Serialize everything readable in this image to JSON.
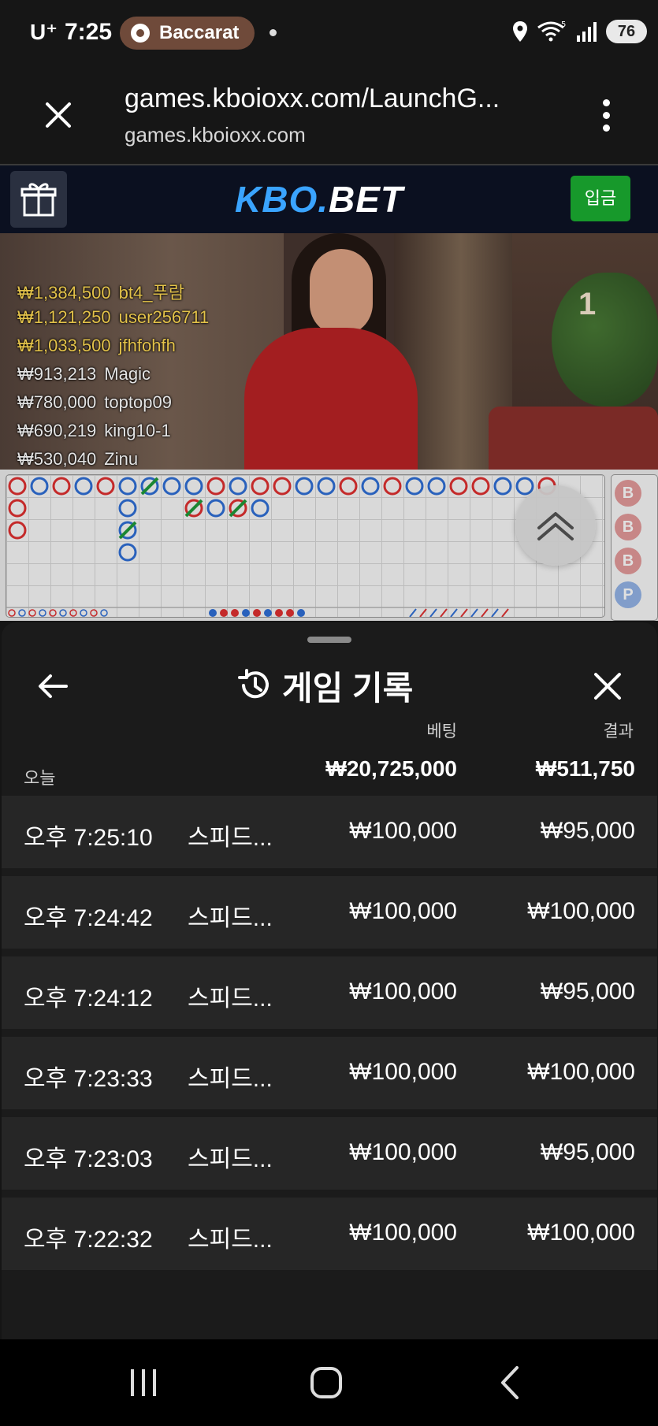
{
  "status_bar": {
    "carrier": "U⁺",
    "time": "7:25",
    "app_chip": "Baccarat",
    "battery": "76"
  },
  "browser": {
    "url_title": "games.kboioxx.com/LaunchG...",
    "domain": "games.kboioxx.com"
  },
  "site_header": {
    "logo_part1": "KBO.",
    "logo_part2": "BET",
    "deposit_label": "입금"
  },
  "video": {
    "shoe_number": "1",
    "winners": [
      {
        "amount": "₩1,384,500",
        "user": "bt4_푸람",
        "highlight": true
      },
      {
        "amount": "₩1,121,250",
        "user": "user256711",
        "highlight": true
      },
      {
        "amount": "₩1,033,500",
        "user": "jfhfohfh",
        "highlight": true
      },
      {
        "amount": "₩913,213",
        "user": "Magic",
        "highlight": false
      },
      {
        "amount": "₩780,000",
        "user": "toptop09",
        "highlight": false
      },
      {
        "amount": "₩690,219",
        "user": "king10-1",
        "highlight": false
      },
      {
        "amount": "₩530,040",
        "user": "Zinu",
        "highlight": false
      }
    ]
  },
  "roadmap": {
    "bead_road": [
      "B",
      "B",
      "B",
      "P"
    ]
  },
  "history": {
    "title": "게임 기록",
    "bet_header": "베팅",
    "result_header": "결과",
    "today_label": "오늘",
    "total_bet": "₩20,725,000",
    "total_result": "₩511,750",
    "rows": [
      {
        "time": "오후 7:25:10",
        "game": "스피드...",
        "bet": "₩100,000",
        "result": "₩95,000"
      },
      {
        "time": "오후 7:24:42",
        "game": "스피드...",
        "bet": "₩100,000",
        "result": "₩100,000"
      },
      {
        "time": "오후 7:24:12",
        "game": "스피드...",
        "bet": "₩100,000",
        "result": "₩95,000"
      },
      {
        "time": "오후 7:23:33",
        "game": "스피드...",
        "bet": "₩100,000",
        "result": "₩100,000"
      },
      {
        "time": "오후 7:23:03",
        "game": "스피드...",
        "bet": "₩100,000",
        "result": "₩95,000"
      },
      {
        "time": "오후 7:22:32",
        "game": "스피드...",
        "bet": "₩100,000",
        "result": "₩100,000"
      }
    ]
  },
  "colors": {
    "banker": "#e03030",
    "player": "#2f6fd6",
    "tie": "#1f9a3a",
    "deposit": "#17992b",
    "logo_accent": "#3aa4ff"
  }
}
